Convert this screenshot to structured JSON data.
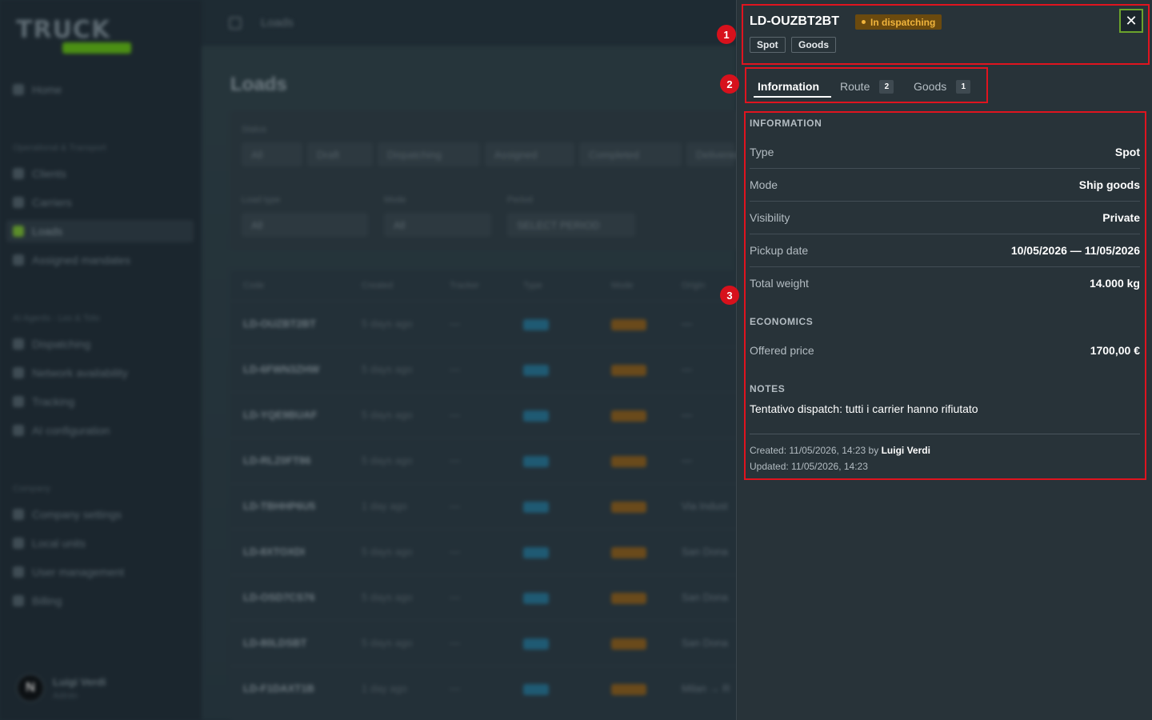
{
  "background": {
    "logo_text": "TRUCK",
    "topbar_title": "Loads",
    "page_title": "Loads",
    "nav": [
      {
        "label": "Home",
        "icon": "home-icon"
      },
      {
        "label": "Operational & Transport",
        "section": true
      },
      {
        "label": "Clients",
        "icon": "clients-icon"
      },
      {
        "label": "Carriers",
        "icon": "carriers-icon"
      },
      {
        "label": "Loads",
        "icon": "loads-icon",
        "active": true
      },
      {
        "label": "Assigned mandates",
        "icon": "mandates-icon"
      },
      {
        "label": "AI Agents - Lex & Toto",
        "section": true
      },
      {
        "label": "Dispatching",
        "icon": "dispatch-icon"
      },
      {
        "label": "Network availability",
        "icon": "network-icon"
      },
      {
        "label": "Tracking",
        "icon": "tracking-icon"
      },
      {
        "label": "AI configuration",
        "icon": "ai-config-icon"
      },
      {
        "label": "Company",
        "section": true
      },
      {
        "label": "Company settings",
        "icon": "company-icon"
      },
      {
        "label": "Local units",
        "icon": "units-icon"
      },
      {
        "label": "User management",
        "icon": "users-icon"
      },
      {
        "label": "Billing",
        "icon": "billing-icon"
      }
    ],
    "user": {
      "initial": "N",
      "name": "Luigi Verdi",
      "role": "Admin"
    },
    "filters": {
      "status_label": "Status",
      "status_pills": [
        "All",
        "Draft",
        "Dispatching",
        "Assigned",
        "Completed",
        "Delivered"
      ],
      "load_type_label": "Load type",
      "load_type_value": "All",
      "mode_label": "Mode",
      "mode_value": "All",
      "period_label": "Period",
      "period_value": "SELECT PERIOD"
    },
    "table": {
      "headers": [
        "Code",
        "Created",
        "Tracker",
        "Type",
        "Mode",
        "Origin"
      ],
      "rows": [
        {
          "code": "LD-OUZBT2BT",
          "created": "5 days ago",
          "origin": "—"
        },
        {
          "code": "LD-6FWN3ZHW",
          "created": "5 days ago",
          "origin": "—"
        },
        {
          "code": "LD-YQE9BUAF",
          "created": "5 days ago",
          "origin": "—"
        },
        {
          "code": "LD-RLZ0FT86",
          "created": "5 days ago",
          "origin": "—"
        },
        {
          "code": "LD-TBHHP6U5",
          "created": "1 day ago",
          "origin": "Via Indust"
        },
        {
          "code": "LD-8XTOXDI",
          "created": "5 days ago",
          "origin": "San Dona"
        },
        {
          "code": "LD-OSD7CS76",
          "created": "5 days ago",
          "origin": "San Dona"
        },
        {
          "code": "LD-80LDSBT",
          "created": "5 days ago",
          "origin": "San Dona"
        },
        {
          "code": "LD-F1DAXT1B",
          "created": "1 day ago",
          "origin": "Milan → R"
        }
      ]
    }
  },
  "drawer": {
    "code": "LD-OUZBT2BT",
    "status": "In dispatching",
    "tags": [
      "Spot",
      "Goods"
    ],
    "close_icon": "close-icon",
    "tabs": [
      {
        "label": "Information",
        "count": null,
        "active": true
      },
      {
        "label": "Route",
        "count": "2"
      },
      {
        "label": "Goods",
        "count": "1"
      }
    ],
    "information": {
      "heading": "INFORMATION",
      "rows": [
        {
          "label": "Type",
          "value": "Spot"
        },
        {
          "label": "Mode",
          "value": "Ship goods"
        },
        {
          "label": "Visibility",
          "value": "Private"
        },
        {
          "label": "Pickup date",
          "value": "10/05/2026 — 11/05/2026"
        },
        {
          "label": "Total weight",
          "value": "14.000 kg"
        }
      ]
    },
    "economics": {
      "heading": "ECONOMICS",
      "rows": [
        {
          "label": "Offered price",
          "value": "1700,00 €"
        }
      ]
    },
    "notes": {
      "heading": "NOTES",
      "text": "Tentativo dispatch: tutti i carrier hanno rifiutato"
    },
    "footer": {
      "created_prefix": "Created: 11/05/2026, 14:23 by",
      "created_by": "Luigi Verdi",
      "updated": "Updated: 11/05/2026, 14:23"
    }
  },
  "annotations": [
    "1",
    "2",
    "3"
  ],
  "colors": {
    "accent": "#6ba32c",
    "status_bg": "#6b4a0e",
    "status_fg": "#f0b43c",
    "highlight": "#e0141f"
  }
}
